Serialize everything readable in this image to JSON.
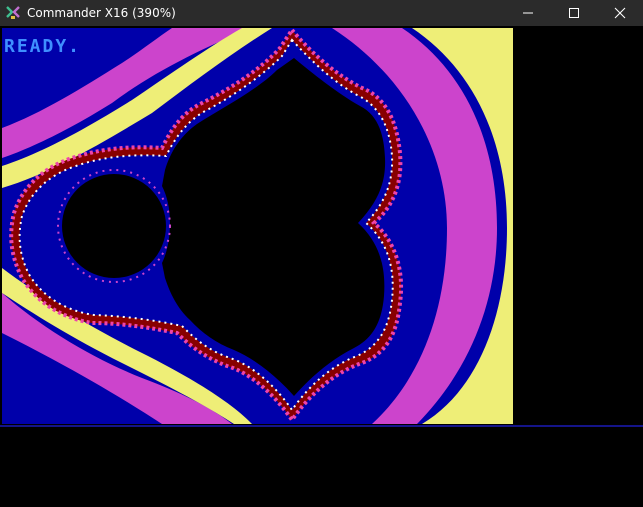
{
  "window": {
    "title": "Commander X16 (390%)",
    "icon": "commander-x16-icon"
  },
  "controls": {
    "minimize_icon": "minimize-icon",
    "maximize_icon": "maximize-icon",
    "close_icon": "close-icon"
  },
  "screen": {
    "prompt": "READY.",
    "colors": {
      "background": "#000000",
      "fractal_blue": "#0000aa",
      "magenta": "#cc44cc",
      "yellow": "#eeee77",
      "dark_red": "#880000",
      "interior": "#000000",
      "prompt_text": "#3f8fff"
    }
  }
}
